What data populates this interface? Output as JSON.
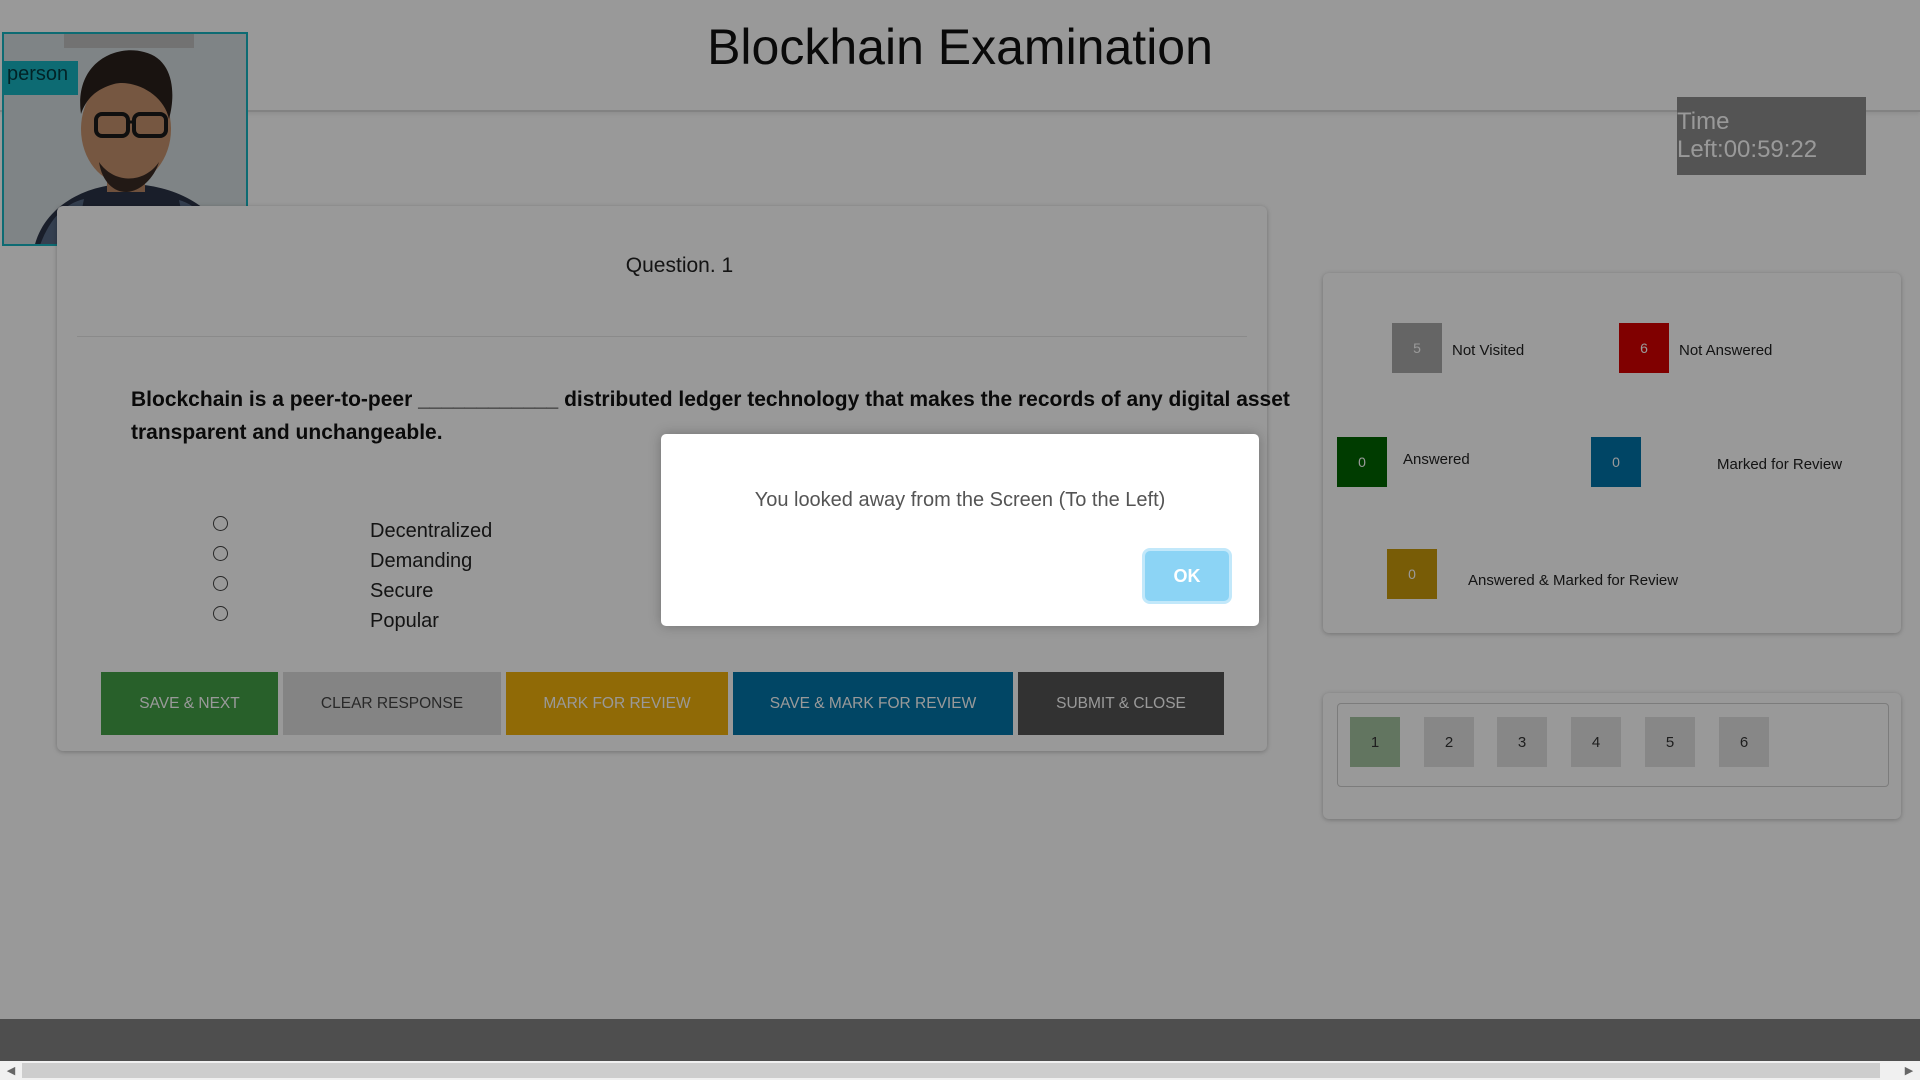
{
  "header": {
    "title": "Blockhain Examination"
  },
  "timer": {
    "text": "Time Left:00:59:22"
  },
  "webcam": {
    "label": "person"
  },
  "question": {
    "number_label": "Question. 1",
    "text": "Blockchain is a peer-to-peer ____________ distributed ledger technology that makes the records of any digital asset transparent and unchangeable.",
    "options": [
      "Decentralized",
      "Demanding",
      "Secure",
      "Popular"
    ],
    "selected": null
  },
  "actions": {
    "save_next": "SAVE & NEXT",
    "clear_response": "CLEAR RESPONSE",
    "mark_review": "MARK FOR REVIEW",
    "save_mark_review": "SAVE & MARK FOR REVIEW",
    "submit_close": "SUBMIT & CLOSE"
  },
  "status": {
    "not_visited": {
      "count": "5",
      "label": "Not Visited",
      "color": "#a8a8a8"
    },
    "not_answered": {
      "count": "6",
      "label": "Not Answered",
      "color": "#d50000"
    },
    "answered": {
      "count": "0",
      "label": "Answered",
      "color": "#006400"
    },
    "marked_review": {
      "count": "0",
      "label": "Marked for Review",
      "color": "#0173a8"
    },
    "answered_marked": {
      "count": "0",
      "label": "Answered & Marked for Review",
      "color": "#c99a0a"
    }
  },
  "palette": {
    "buttons": [
      "1",
      "2",
      "3",
      "4",
      "5",
      "6"
    ],
    "current": "1"
  },
  "dialog": {
    "message": "You looked away from the Screen (To the Left)",
    "ok_label": "OK"
  },
  "colors": {
    "save_next": "#43a047",
    "clear": "#dcdcdc",
    "mark": "#f0b10b",
    "save_mark": "#0276a9",
    "submit": "#545454",
    "current_question": "#a4c3a0"
  }
}
